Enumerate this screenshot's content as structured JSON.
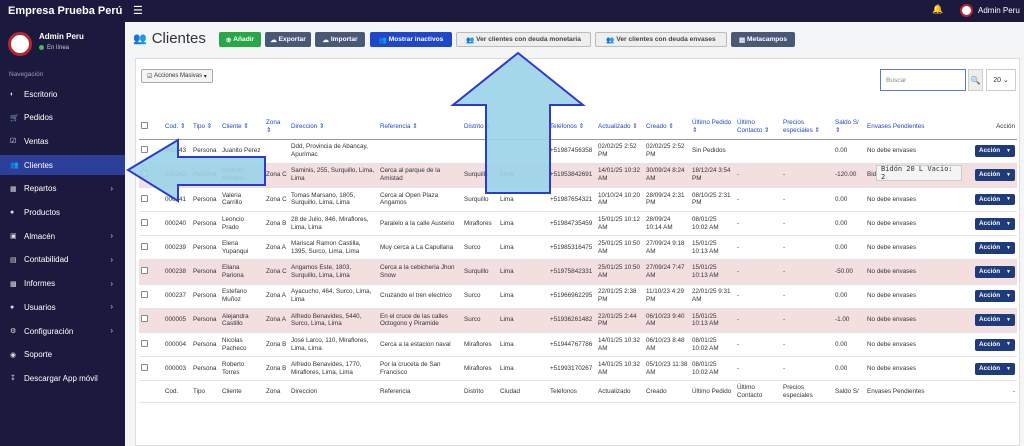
{
  "topbar": {
    "brand": "Empresa Prueba Perú",
    "user": "Admin Peru"
  },
  "sidebar": {
    "user_name": "Admin Peru",
    "status": "En línea",
    "nav_header": "Navegación",
    "items": [
      {
        "label": "Escritorio",
        "icon": "dashboard-icon"
      },
      {
        "label": "Pedidos",
        "icon": "cart-icon"
      },
      {
        "label": "Ventas",
        "icon": "check-square-icon"
      },
      {
        "label": "Clientes",
        "icon": "users-icon"
      },
      {
        "label": "Repartos",
        "icon": "truck-icon"
      },
      {
        "label": "Productos",
        "icon": "circle-icon"
      },
      {
        "label": "Almacén",
        "icon": "store-icon"
      },
      {
        "label": "Contabilidad",
        "icon": "ledger-icon"
      },
      {
        "label": "Informes",
        "icon": "chart-icon"
      },
      {
        "label": "Usuarios",
        "icon": "user-icon"
      },
      {
        "label": "Configuración",
        "icon": "cogs-icon"
      },
      {
        "label": "Soporte",
        "icon": "support-icon"
      },
      {
        "label": "Descargar App móvil",
        "icon": "download-icon"
      }
    ]
  },
  "page": {
    "title": "Clientes"
  },
  "toolbar": {
    "add": "Añadir",
    "export": "Exportar",
    "import": "Importar",
    "inactive": "Mostrar inactivos",
    "debt_money": "Ver clientes con deuda monetaria",
    "debt_containers": "Ver clientes con deuda envases",
    "metafields": "Metacampos"
  },
  "card": {
    "bulk_actions": "Acciones Masivas",
    "search_placeholder": "Buscar",
    "page_size": "20"
  },
  "table": {
    "headers": [
      "Cod.",
      "Tipo",
      "Cliente",
      "Zona",
      "Direccion",
      "Referencia",
      "Distrito",
      "",
      "Teléfonos",
      "Actualizado",
      "Creado",
      "Último Pedido",
      "Último Contacto",
      "Precios especiales",
      "Saldo S/",
      "Envases Pendientes",
      "Acción"
    ],
    "footer": [
      "Cod.",
      "Tipo",
      "Cliente",
      "Zona",
      "Direccion",
      "Referencia",
      "Distrito",
      "Ciudad",
      "Teléfonos",
      "Actualizado",
      "Creado",
      "Último Pedido",
      "Último Contacto",
      "Precios especiales",
      "Saldo S/",
      "Envases Pendientes",
      "-"
    ],
    "action_label": "Acción",
    "rows": [
      {
        "cod": "000243",
        "tipo": "Persona",
        "cliente": "Juanito Perez",
        "zona": "",
        "direccion": "Ddd, Provincia de Abancay, Apurimac",
        "referencia": "",
        "distrito": "",
        "ciudad": "",
        "telefono": "+51987456358",
        "actualizado": "02/02/25 2:52 PM",
        "creado": "02/02/25 2:52 PM",
        "ultimo_pedido": "Sin Pedidos",
        "ultimo_contacto": "",
        "precios": "",
        "saldo": "0.00",
        "envases": "No debe envases",
        "pink": false
      },
      {
        "cod": "000242",
        "tipo": "Persona",
        "cliente": "Ricardo Morales",
        "zona": "Zona C",
        "direccion": "Saminis, 255, Surquillo, Lima, Lima",
        "referencia": "Cerca al parque de la Amistad",
        "distrito": "Surquillo",
        "ciudad": "Lima",
        "telefono": "+51953842691",
        "actualizado": "14/01/25 10:32 AM",
        "creado": "30/09/24 8:24 AM",
        "ultimo_pedido": "18/12/24 3:54 PM",
        "ultimo_contacto": "-",
        "precios": "-",
        "saldo": "-120.00",
        "envases": "Bidón 20 L Vacío: 2",
        "pink": true
      },
      {
        "cod": "000241",
        "tipo": "Persona",
        "cliente": "Valeria Carrillo",
        "zona": "Zona C",
        "direccion": "Tomas Marsano, 1805, Surquillo, Lima, Lima",
        "referencia": "Cerca al Open Plaza Angamos",
        "distrito": "Surquillo",
        "ciudad": "Lima",
        "telefono": "+51987654321",
        "actualizado": "10/10/24 10:20 AM",
        "creado": "28/09/24 2:31 PM",
        "ultimo_pedido": "08/10/25 2:31 PM",
        "ultimo_contacto": "-",
        "precios": "-",
        "saldo": "0.00",
        "envases": "No debe envases",
        "pink": false
      },
      {
        "cod": "000240",
        "tipo": "Persona",
        "cliente": "Leoncio Prado",
        "zona": "Zona B",
        "direccion": "28 de Julio, 846, Miraflores, Lima, Lima",
        "referencia": "Paralelo a la calle Austerio",
        "distrito": "Miraflores",
        "ciudad": "Lima",
        "telefono": "+51984735459",
        "actualizado": "15/01/25 10:12 AM",
        "creado": "28/09/24 10:14 AM",
        "ultimo_pedido": "08/01/25 10:02 AM",
        "ultimo_contacto": "-",
        "precios": "-",
        "saldo": "0.00",
        "envases": "No debe envases",
        "pink": false
      },
      {
        "cod": "000239",
        "tipo": "Persona",
        "cliente": "Elena Yupanqui",
        "zona": "Zona A",
        "direccion": "Mariscal Ramon Castilla, 1395, Surco, Lima, Lima",
        "referencia": "Muy cerca a La Capullana",
        "distrito": "Surco",
        "ciudad": "Lima",
        "telefono": "+51985316475",
        "actualizado": "25/01/25 10:50 AM",
        "creado": "27/09/24 9:18 AM",
        "ultimo_pedido": "15/01/25 10:13 AM",
        "ultimo_contacto": "-",
        "precios": "-",
        "saldo": "0.00",
        "envases": "No debe envases",
        "pink": false
      },
      {
        "cod": "000238",
        "tipo": "Persona",
        "cliente": "Eliana Pariona",
        "zona": "Zona C",
        "direccion": "Angamos Este, 1803, Surquillo, Lima, Lima",
        "referencia": "Cerca a la cebicheria Jhon Snow",
        "distrito": "Surquillo",
        "ciudad": "Lima",
        "telefono": "+51975842331",
        "actualizado": "25/01/25 10:50 AM",
        "creado": "27/09/24 7:47 AM",
        "ultimo_pedido": "15/01/25 10:13 AM",
        "ultimo_contacto": "-",
        "precios": "-",
        "saldo": "-50.00",
        "envases": "No debe envases",
        "pink": true
      },
      {
        "cod": "000237",
        "tipo": "Persona",
        "cliente": "Estefano Muñoz",
        "zona": "Zona A",
        "direccion": "Ayacucho, 464, Surco, Lima, Lima",
        "referencia": "Cruzando el tren electrico",
        "distrito": "Surco",
        "ciudad": "Lima",
        "telefono": "+51966962295",
        "actualizado": "22/01/25 2:38 PM",
        "creado": "11/10/23 4:29 PM",
        "ultimo_pedido": "22/01/25 9:31 AM",
        "ultimo_contacto": "-",
        "precios": "-",
        "saldo": "0.00",
        "envases": "No debe envases",
        "pink": false
      },
      {
        "cod": "000005",
        "tipo": "Persona",
        "cliente": "Alejandra Castillo",
        "zona": "Zona A",
        "direccion": "Alfredo Benavides, 5440, Surco, Lima, Lima",
        "referencia": "En el cruce de las calles Octogono y Piramide",
        "distrito": "Surco",
        "ciudad": "Lima",
        "telefono": "+51936261482",
        "actualizado": "22/01/25 2:44 PM",
        "creado": "06/10/23 9:40 AM",
        "ultimo_pedido": "15/01/25 10:13 AM",
        "ultimo_contacto": "-",
        "precios": "-",
        "saldo": "-1.00",
        "envases": "No debe envases",
        "pink": true
      },
      {
        "cod": "000004",
        "tipo": "Persona",
        "cliente": "Nicolas Pacheco",
        "zona": "Zona B",
        "direccion": "José Larco, 110, Miraflores, Lima, Lima",
        "referencia": "Cerca a la estacion naval",
        "distrito": "Miraflores",
        "ciudad": "Lima",
        "telefono": "+51944767786",
        "actualizado": "14/01/25 10:32 AM",
        "creado": "06/10/23 8:48 AM",
        "ultimo_pedido": "08/01/25 10:02 AM",
        "ultimo_contacto": "-",
        "precios": "-",
        "saldo": "0.00",
        "envases": "No debe envases",
        "pink": false
      },
      {
        "cod": "000003",
        "tipo": "Persona",
        "cliente": "Roberto Torres",
        "zona": "Zona B",
        "direccion": "Alfredo Benavides, 1770, Miraflores, Lima, Lima",
        "referencia": "Por la cruceta de San Francisco",
        "distrito": "Miraflores",
        "ciudad": "Lima",
        "telefono": "+51993170267",
        "actualizado": "14/01/25 10:32 AM",
        "creado": "05/10/23 11:38 AM",
        "ultimo_pedido": "08/01/25 10:02 AM",
        "ultimo_contacto": "-",
        "precios": "-",
        "saldo": "0.00",
        "envases": "No debe envases",
        "pink": false
      }
    ]
  },
  "tooltip": {
    "text": "Bidón 20 L Vacío: 2"
  }
}
